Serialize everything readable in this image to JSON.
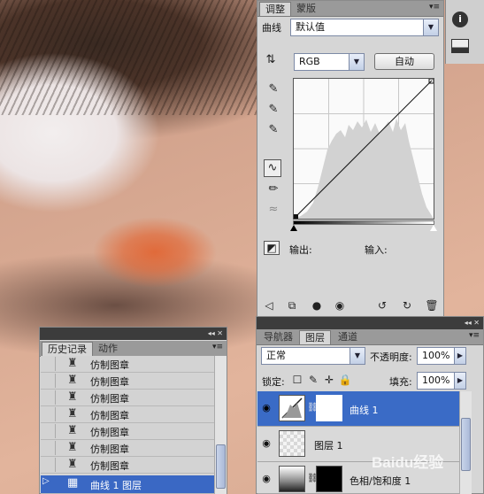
{
  "adjustments_panel": {
    "tabs": [
      "调整",
      "蒙版"
    ],
    "preset_label": "曲线",
    "preset_value": "默认值",
    "channel_value": "RGB",
    "auto_button": "自动",
    "output_label": "输出:",
    "input_label": "输入:"
  },
  "right_dock": {
    "icons": [
      "info-icon",
      "histogram-icon"
    ]
  },
  "history_panel": {
    "tabs": [
      "历史记录",
      "动作"
    ],
    "items": [
      "仿制图章",
      "仿制图章",
      "仿制图章",
      "仿制图章",
      "仿制图章",
      "仿制图章",
      "仿制图章"
    ],
    "selected_item": "曲线 1 图层"
  },
  "layers_panel": {
    "tabs": [
      "导航器",
      "图层",
      "通道"
    ],
    "blend_mode": "正常",
    "opacity_label": "不透明度:",
    "opacity_value": "100%",
    "lock_label": "锁定:",
    "fill_label": "填充:",
    "fill_value": "100%",
    "layers": [
      "曲线 1",
      "图层 1",
      "色相/饱和度 1"
    ]
  },
  "watermark": "Baidu经验"
}
